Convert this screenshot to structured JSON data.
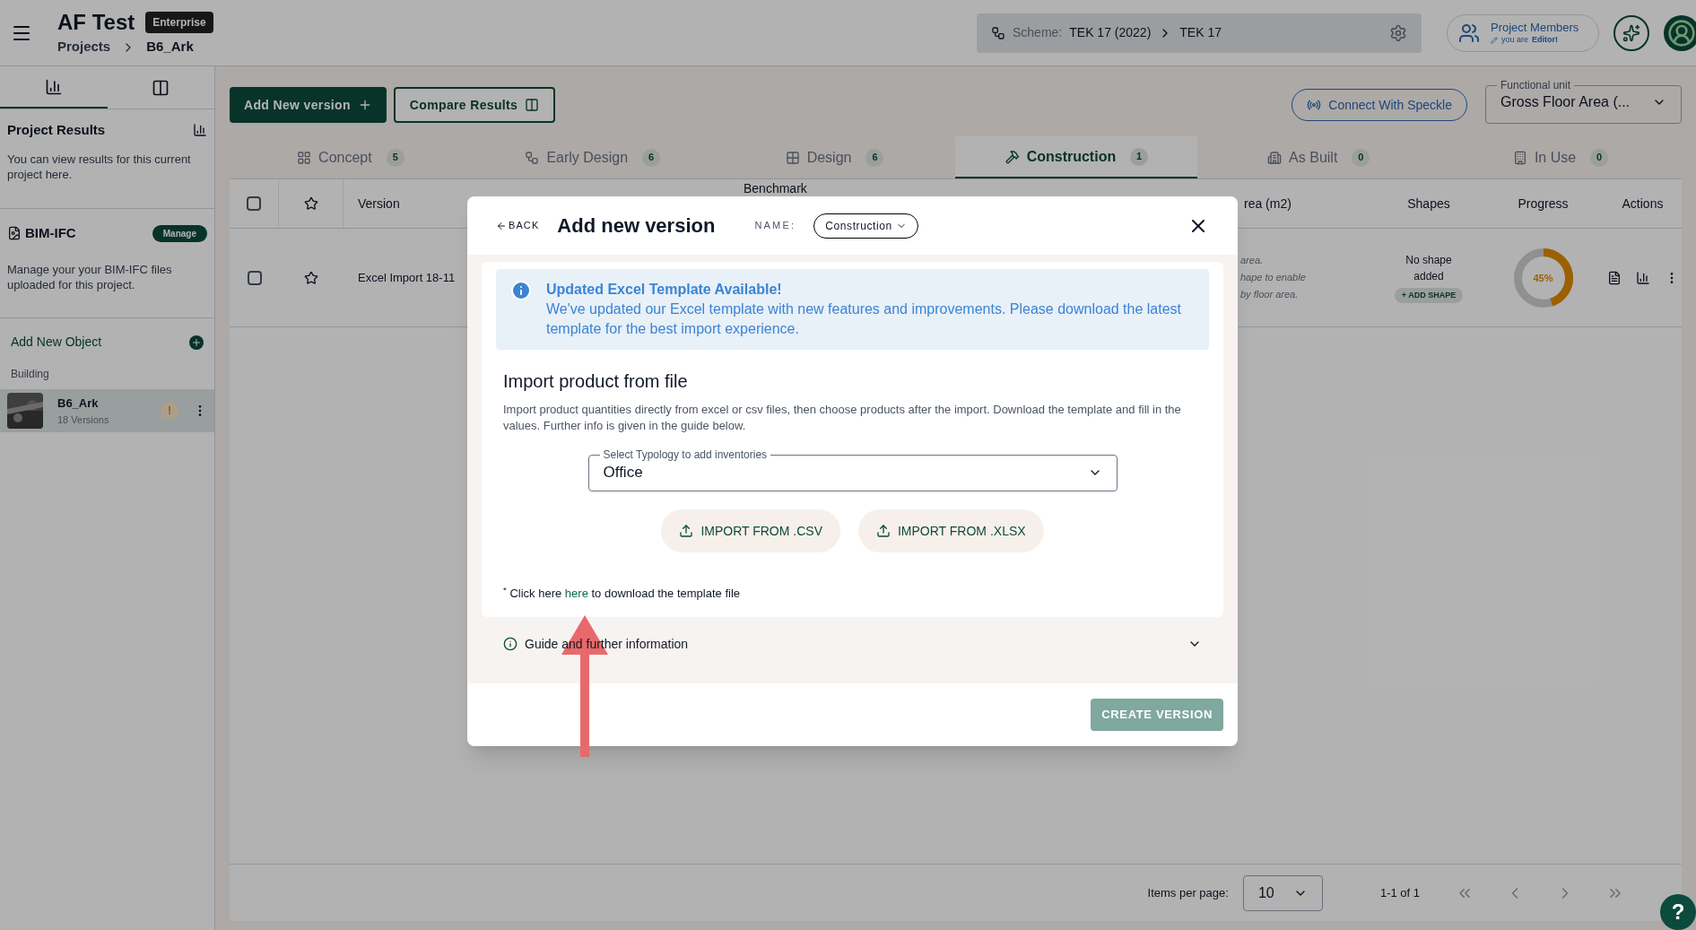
{
  "header": {
    "title": "AF Test",
    "plan_badge": "Enterprise",
    "breadcrumb": [
      "Projects",
      "B6_Ark"
    ],
    "scheme": {
      "label": "Scheme:",
      "value": "TEK 17 (2022)",
      "sub": "TEK 17"
    },
    "members": {
      "title": "Project Members",
      "role_prefix": "you are",
      "role": "Editor!"
    }
  },
  "sidebar": {
    "tabs": [
      {
        "selected": true
      },
      {
        "selected": false
      }
    ],
    "results": {
      "title": "Project Results",
      "text": "You can view results for this current project here."
    },
    "bim": {
      "title": "BIM-IFC",
      "button": "Manage",
      "text": "Manage your your BIM-IFC files uploaded for this project."
    },
    "add_object": "Add New Object",
    "group": "Building",
    "objects": [
      {
        "name": "B6_Ark",
        "versions": "18 Versions",
        "selected": true,
        "warning": "!"
      }
    ]
  },
  "toolbar": {
    "add_version": "Add New version",
    "compare": "Compare Results",
    "speckle": "Connect With Speckle",
    "unit": {
      "label": "Functional unit",
      "value": "Gross Floor Area (..."
    }
  },
  "stages": [
    {
      "label": "Concept",
      "count": "5",
      "selected": false
    },
    {
      "label": "Early Design",
      "count": "6",
      "selected": false
    },
    {
      "label": "Design",
      "count": "6",
      "selected": false
    },
    {
      "label": "Construction",
      "count": "1",
      "selected": true
    },
    {
      "label": "As Built",
      "count": "0",
      "selected": false
    },
    {
      "label": "In Use",
      "count": "0",
      "selected": false
    }
  ],
  "table": {
    "all_checked": false,
    "columns": [
      "Version",
      "Benchmark",
      "rea (m2)",
      "Shapes",
      "Progress",
      "Actions"
    ],
    "rows": [
      {
        "checked": false,
        "starred": false,
        "version": "Excel Import 18-11",
        "area_note": [
          "area.",
          "hape to enable",
          "by floor area."
        ],
        "shapes": "No shape added",
        "add_shape": "+ ADD SHAPE",
        "progress_label": "45%",
        "level": 0.45
      }
    ]
  },
  "pagination": {
    "label": "Items per page:",
    "per_page": "10",
    "range": "1-1 of 1"
  },
  "help": "?",
  "modal": {
    "back": "BACK",
    "title": "Add new version",
    "name_label": "NAME:",
    "name_value": "Construction",
    "notice": {
      "title": "Updated Excel Template Available!",
      "text": "We've updated our Excel template with new features and improvements. Please download the latest template for the best import experience."
    },
    "heading": "Import product from file",
    "description": "Import product quantities directly from excel or csv files, then choose products after the import. Download the template and fill in the values. Further info is given in the guide below.",
    "select": {
      "label": "Select Typology to add inventories",
      "value": "Office"
    },
    "imports": [
      "IMPORT FROM .CSV",
      "IMPORT FROM .XLSX"
    ],
    "download": {
      "mark": "*",
      "before": "Click here",
      "link": "here",
      "after": "to download the template file"
    },
    "guide": {
      "label": "Guide and further information",
      "expanded": false
    },
    "create": "CREATE VERSION",
    "create_disabled": true
  }
}
